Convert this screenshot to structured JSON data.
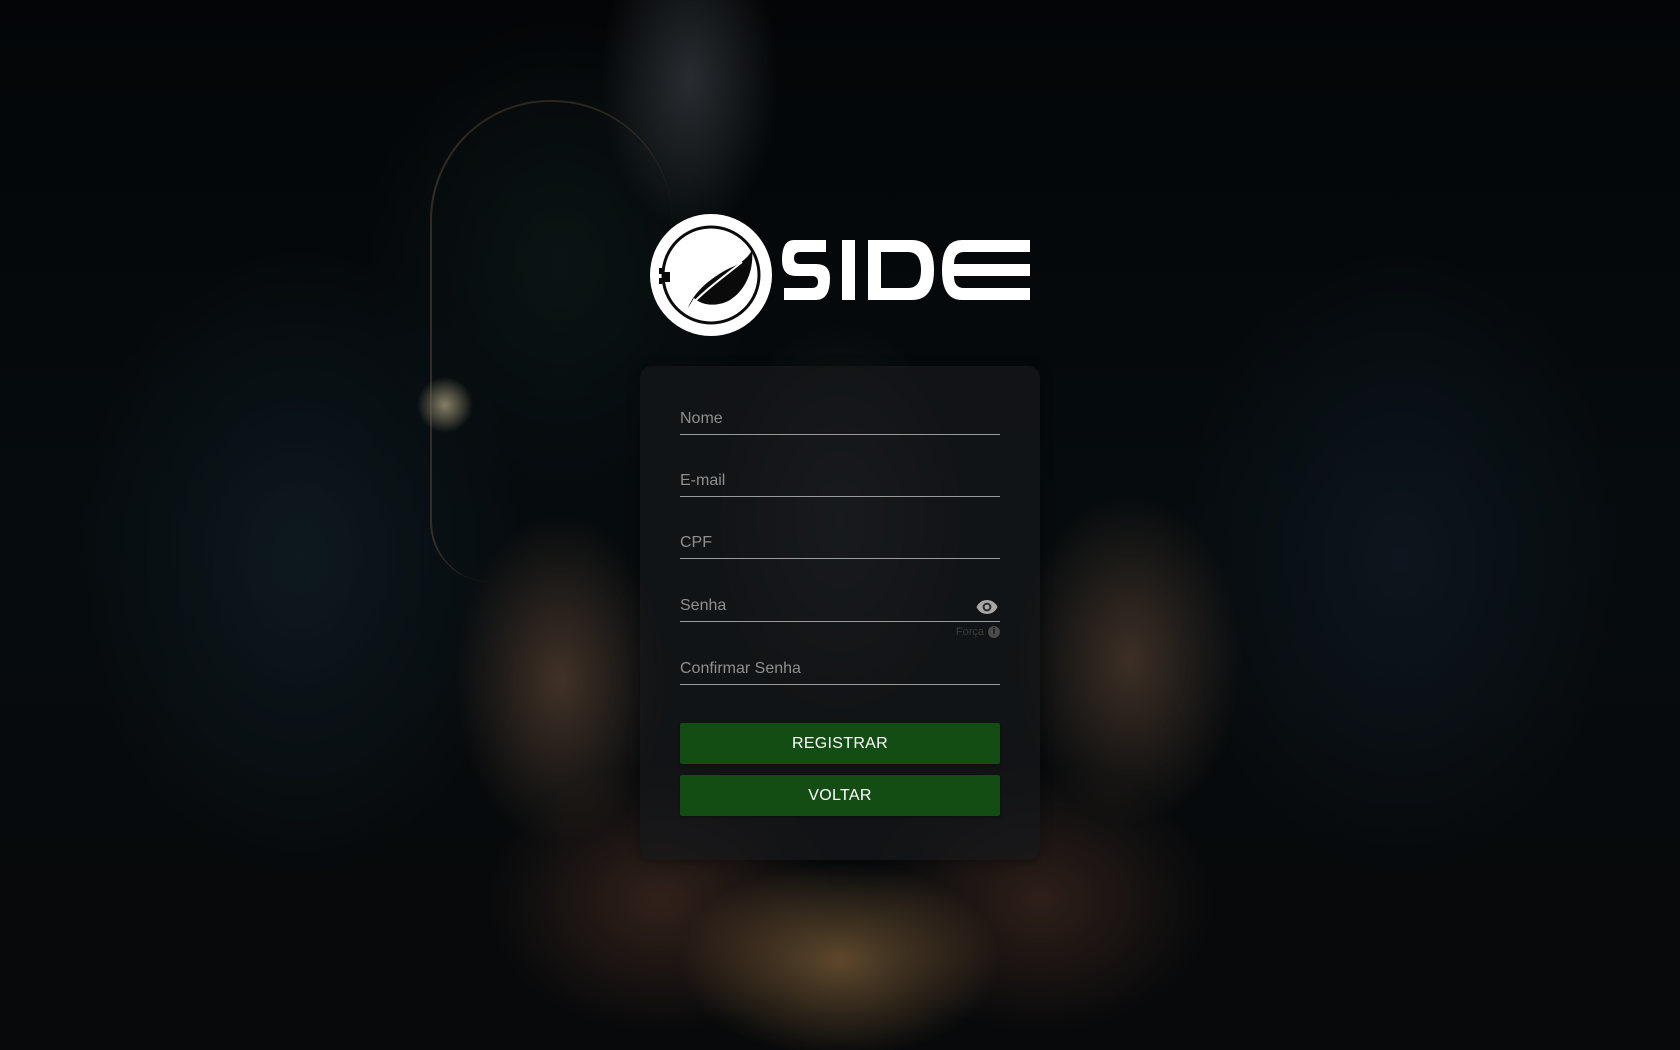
{
  "brand": {
    "name": "SIDE"
  },
  "form": {
    "name_placeholder": "Nome",
    "email_placeholder": "E-mail",
    "cpf_placeholder": "CPF",
    "password_placeholder": "Senha",
    "password_strength_label": "Força",
    "confirm_password_placeholder": "Confirmar Senha",
    "register_label": "REGISTRAR",
    "back_label": "VOLTAR"
  },
  "icons": {
    "password_toggle": "eye-icon",
    "strength_info": "info-icon",
    "logo_mark": "leaf-plug-icon"
  },
  "colors": {
    "button": "#134d13",
    "card": "rgba(22,24,26,0.72)",
    "underline": "#9a9a9a",
    "placeholder": "#8f8f8f"
  }
}
